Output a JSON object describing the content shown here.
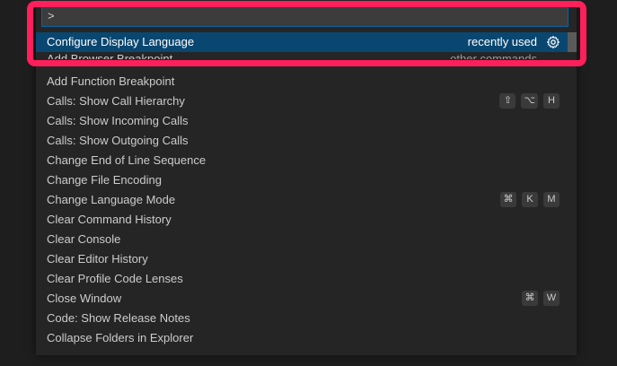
{
  "input": {
    "value": ">"
  },
  "selected": {
    "label": "Configure Display Language",
    "meta": "recently used",
    "icon": "gear-icon"
  },
  "partial": {
    "label": "Add Browser Breakpoint",
    "meta": "other commands"
  },
  "items": [
    {
      "label": "Add Function Breakpoint",
      "keys": []
    },
    {
      "label": "Calls: Show Call Hierarchy",
      "keys": [
        "⇧",
        "⌥",
        "H"
      ]
    },
    {
      "label": "Calls: Show Incoming Calls",
      "keys": []
    },
    {
      "label": "Calls: Show Outgoing Calls",
      "keys": []
    },
    {
      "label": "Change End of Line Sequence",
      "keys": []
    },
    {
      "label": "Change File Encoding",
      "keys": []
    },
    {
      "label": "Change Language Mode",
      "keys": [
        "⌘",
        "K",
        "M"
      ]
    },
    {
      "label": "Clear Command History",
      "keys": []
    },
    {
      "label": "Clear Console",
      "keys": []
    },
    {
      "label": "Clear Editor History",
      "keys": []
    },
    {
      "label": "Clear Profile Code Lenses",
      "keys": []
    },
    {
      "label": "Close Window",
      "keys": [
        "⌘",
        "W"
      ]
    },
    {
      "label": "Code: Show Release Notes",
      "keys": []
    },
    {
      "label": "Collapse Folders in Explorer",
      "keys": []
    }
  ],
  "colors": {
    "highlight": "#ff1f5a",
    "selection": "#094771",
    "background": "#252526"
  }
}
